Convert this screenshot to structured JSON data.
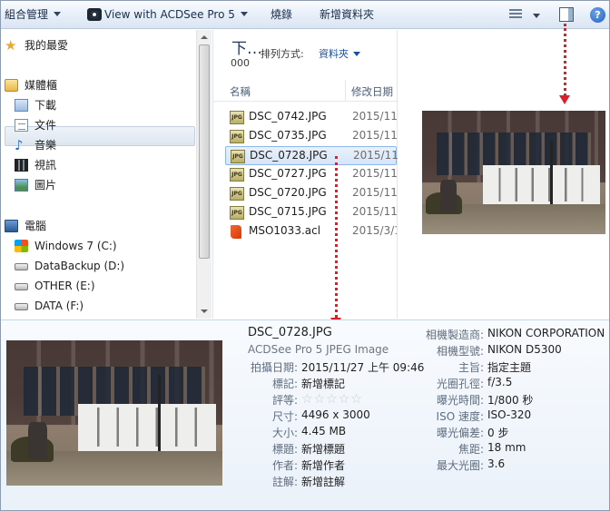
{
  "toolbar": {
    "organize": "組合管理",
    "open_with": "View with ACDSee Pro 5",
    "burn": "燒錄",
    "new_folder": "新增資料夾"
  },
  "nav": {
    "favorites": "我的最愛",
    "libraries": "媒體櫃",
    "items": [
      {
        "label": "下載",
        "icon": "download-folder-icon"
      },
      {
        "label": "文件",
        "icon": "documents-icon"
      },
      {
        "label": "音樂",
        "icon": "music-icon"
      },
      {
        "label": "視訊",
        "icon": "video-icon"
      },
      {
        "label": "圖片",
        "icon": "pictures-icon"
      }
    ],
    "computer": "電腦",
    "drives": [
      {
        "label": "Windows 7 (C:)"
      },
      {
        "label": "DataBackup (D:)"
      },
      {
        "label": "OTHER (E:)"
      },
      {
        "label": "DATA (F:)"
      }
    ]
  },
  "list": {
    "title": "下…",
    "subtitle": "000",
    "sort_label": "排列方式:",
    "sort_value": "資料夾",
    "col_name": "名稱",
    "col_date": "修改日期",
    "files": [
      {
        "name": "DSC_0742.JPG",
        "date": "2015/11/",
        "icon": "JPG"
      },
      {
        "name": "DSC_0735.JPG",
        "date": "2015/11/",
        "icon": "JPG"
      },
      {
        "name": "DSC_0728.JPG",
        "date": "2015/11/",
        "icon": "JPG",
        "selected": true
      },
      {
        "name": "DSC_0727.JPG",
        "date": "2015/11/",
        "icon": "JPG"
      },
      {
        "name": "DSC_0720.JPG",
        "date": "2015/11/",
        "icon": "JPG"
      },
      {
        "name": "DSC_0715.JPG",
        "date": "2015/11/",
        "icon": "JPG"
      },
      {
        "name": "MSO1033.acl",
        "date": "2015/3/1",
        "icon": "ACL"
      }
    ]
  },
  "details": {
    "filename": "DSC_0728.JPG",
    "filetype": "ACDSee Pro 5 JPEG Image",
    "left": [
      {
        "label": "拍攝日期:",
        "value": "2015/11/27 上午 09:46"
      },
      {
        "label": "標記:",
        "value": "新增標記"
      },
      {
        "label": "評等:",
        "value": ""
      },
      {
        "label": "尺寸:",
        "value": "4496 x 3000"
      },
      {
        "label": "大小:",
        "value": "4.45 MB"
      },
      {
        "label": "標題:",
        "value": "新增標題"
      },
      {
        "label": "作者:",
        "value": "新增作者"
      },
      {
        "label": "註解:",
        "value": "新增註解"
      }
    ],
    "right": [
      {
        "label": "相機製造商:",
        "value": "NIKON CORPORATION"
      },
      {
        "label": "相機型號:",
        "value": "NIKON D5300"
      },
      {
        "label": "主旨:",
        "value": "指定主題"
      },
      {
        "label": "光圈孔徑:",
        "value": "f/3.5"
      },
      {
        "label": "曝光時間:",
        "value": "1/800 秒"
      },
      {
        "label": "ISO 速度:",
        "value": "ISO-320"
      },
      {
        "label": "曝光偏差:",
        "value": "0 步"
      },
      {
        "label": "焦距:",
        "value": "18 mm"
      },
      {
        "label": "最大光圈:",
        "value": "3.6"
      }
    ],
    "rating_stars": 0
  },
  "colors": {
    "arrow": "#d8202a",
    "selection": "#d5e5f8",
    "link": "#1a4f9c"
  }
}
